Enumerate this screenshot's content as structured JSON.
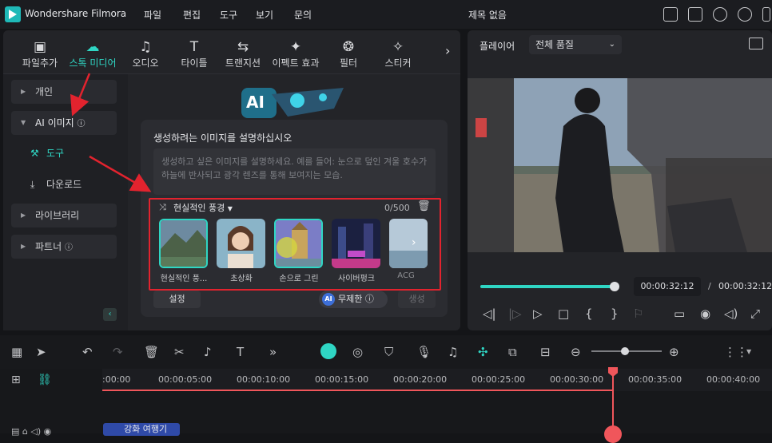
{
  "app": {
    "name": "Wondershare Filmora",
    "project_title": "제목 없음"
  },
  "menu": [
    "파일",
    "편집",
    "도구",
    "보기",
    "문의"
  ],
  "tabs": [
    {
      "label": "파일추가",
      "icon": "image-icon"
    },
    {
      "label": "스톡 미디어",
      "icon": "cloud-icon"
    },
    {
      "label": "오디오",
      "icon": "music-icon"
    },
    {
      "label": "타이틀",
      "icon": "text-icon"
    },
    {
      "label": "트랜지션",
      "icon": "transition-icon"
    },
    {
      "label": "이펙트 효과",
      "icon": "effects-icon"
    },
    {
      "label": "필터",
      "icon": "filter-icon"
    },
    {
      "label": "스티커",
      "icon": "sticker-icon"
    }
  ],
  "sidebar": {
    "personal": "개인",
    "ai_image": "AI 이미지",
    "tools": "도구",
    "download": "다운로드",
    "library": "라이브러리",
    "partner": "파트너"
  },
  "ai_panel": {
    "badge": "AI",
    "heading": "생성하려는 이미지를 설명하십시오",
    "placeholder": "생성하고 싶은 이미지를 설명하세요. 예를 들어: 눈으로 덮인 겨울 호수가 하늘에 반사되고 광각 렌즈를 통해 보여지는 모습.",
    "style_selected": "현실적인 풍경",
    "char_count": "0/500",
    "styles": [
      "현실적인 풍...",
      "초상화",
      "손으로 그린",
      "사이버펑크",
      "ACG"
    ],
    "settings_label": "설정",
    "unlimited_label": "무제한",
    "generate_label": "생성"
  },
  "player": {
    "label": "플레이어",
    "quality": "전체 품질",
    "current_time": "00:00:32:12",
    "total_time": "00:00:32:12",
    "separator": "/",
    "progress": 1.0
  },
  "timeline": {
    "ticks": [
      ":00:00",
      "00:00:05:00",
      "00:00:10:00",
      "00:00:15:00",
      "00:00:20:00",
      "00:00:25:00",
      "00:00:30:00",
      "00:00:35:00",
      "00:00:40:00"
    ],
    "clip_label": "강화 여행기"
  },
  "colors": {
    "accent": "#2fd6c4",
    "annotation": "#e2232e",
    "playhead": "#f0565b"
  }
}
